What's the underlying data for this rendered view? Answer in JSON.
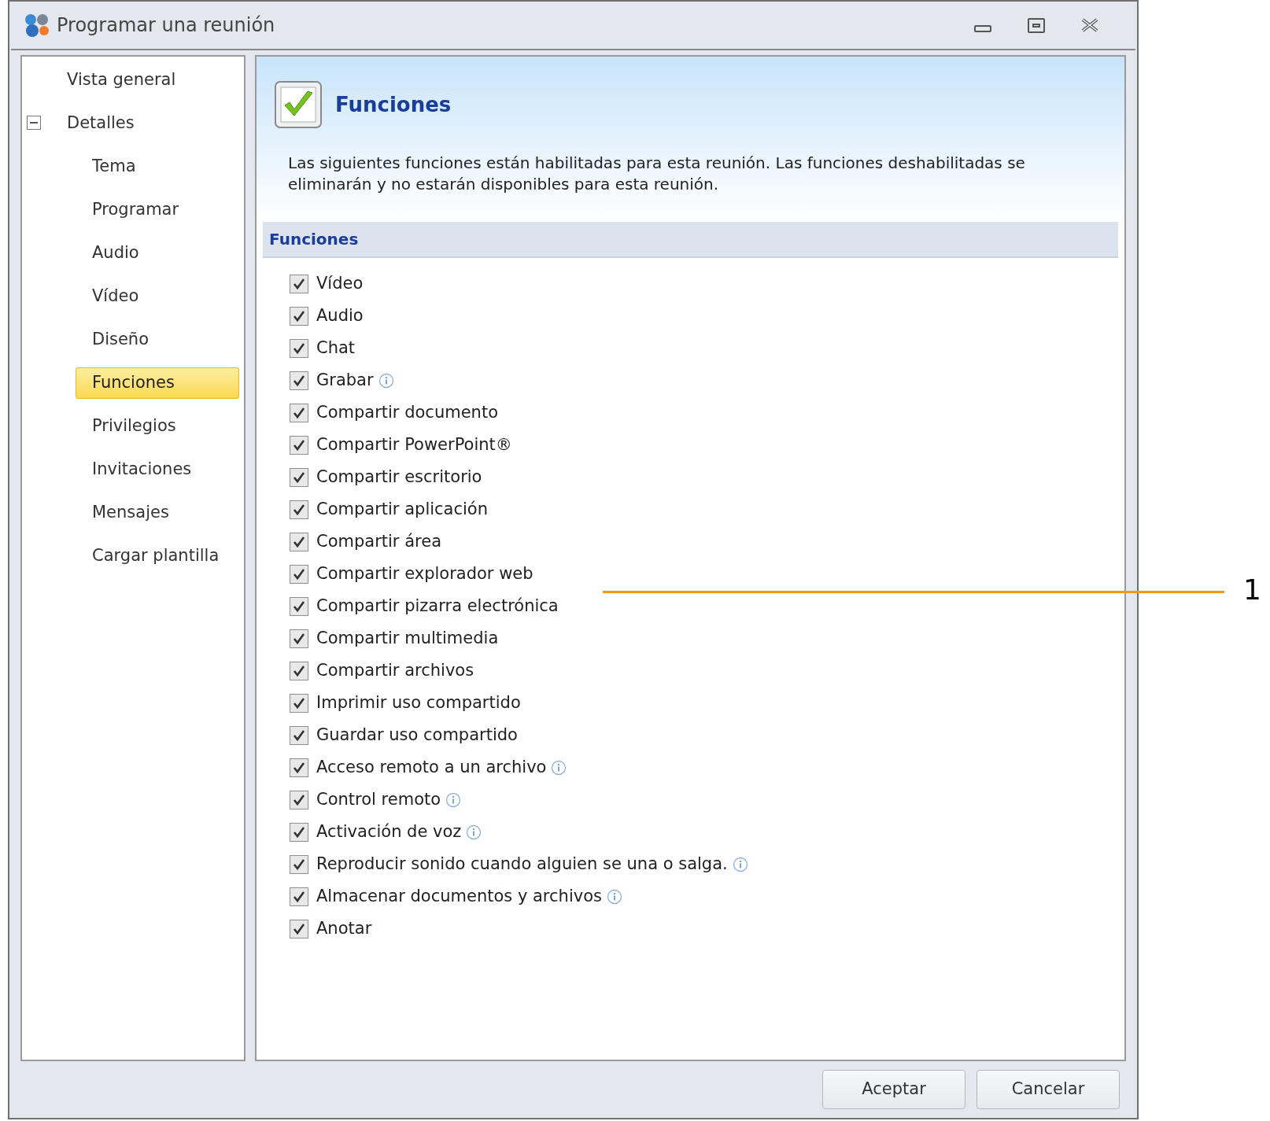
{
  "window": {
    "title": "Programar una reunión"
  },
  "sidebar": {
    "items": [
      {
        "label": "Vista general",
        "selected": false
      },
      {
        "label": "Detalles",
        "selected": false,
        "expanded": true,
        "children": [
          {
            "label": "Tema",
            "selected": false
          },
          {
            "label": "Programar",
            "selected": false
          },
          {
            "label": "Audio",
            "selected": false
          },
          {
            "label": "Vídeo",
            "selected": false
          },
          {
            "label": "Diseño",
            "selected": false
          },
          {
            "label": "Funciones",
            "selected": true
          },
          {
            "label": "Privilegios",
            "selected": false
          },
          {
            "label": "Invitaciones",
            "selected": false
          },
          {
            "label": "Mensajes",
            "selected": false
          },
          {
            "label": "Cargar plantilla",
            "selected": false
          }
        ]
      }
    ]
  },
  "header": {
    "title": "Funciones",
    "description": "Las siguientes funciones están habilitadas para esta reunión. Las funciones deshabilitadas se eliminarán y no estarán disponibles para esta reunión."
  },
  "section": {
    "title": "Funciones"
  },
  "features": [
    {
      "label": "Vídeo",
      "checked": true,
      "info": false
    },
    {
      "label": "Audio",
      "checked": true,
      "info": false
    },
    {
      "label": "Chat",
      "checked": true,
      "info": false
    },
    {
      "label": "Grabar",
      "checked": true,
      "info": true
    },
    {
      "label": "Compartir documento",
      "checked": true,
      "info": false
    },
    {
      "label": "Compartir PowerPoint®",
      "checked": true,
      "info": false
    },
    {
      "label": "Compartir escritorio",
      "checked": true,
      "info": false
    },
    {
      "label": "Compartir aplicación",
      "checked": true,
      "info": false
    },
    {
      "label": "Compartir área",
      "checked": true,
      "info": false
    },
    {
      "label": "Compartir explorador web",
      "checked": true,
      "info": false
    },
    {
      "label": "Compartir pizarra electrónica",
      "checked": true,
      "info": false
    },
    {
      "label": "Compartir multimedia",
      "checked": true,
      "info": false
    },
    {
      "label": "Compartir archivos",
      "checked": true,
      "info": false
    },
    {
      "label": "Imprimir uso compartido",
      "checked": true,
      "info": false
    },
    {
      "label": "Guardar uso compartido",
      "checked": true,
      "info": false
    },
    {
      "label": "Acceso remoto a un archivo",
      "checked": true,
      "info": true
    },
    {
      "label": "Control remoto",
      "checked": true,
      "info": true
    },
    {
      "label": "Activación de voz",
      "checked": true,
      "info": true
    },
    {
      "label": "Reproducir sonido cuando alguien se una o salga.",
      "checked": true,
      "info": true
    },
    {
      "label": "Almacenar documentos y archivos",
      "checked": true,
      "info": true
    },
    {
      "label": "Anotar",
      "checked": true,
      "info": false
    }
  ],
  "buttons": [
    "Aceptar",
    "Cancelar"
  ],
  "callout": {
    "label": "1"
  }
}
